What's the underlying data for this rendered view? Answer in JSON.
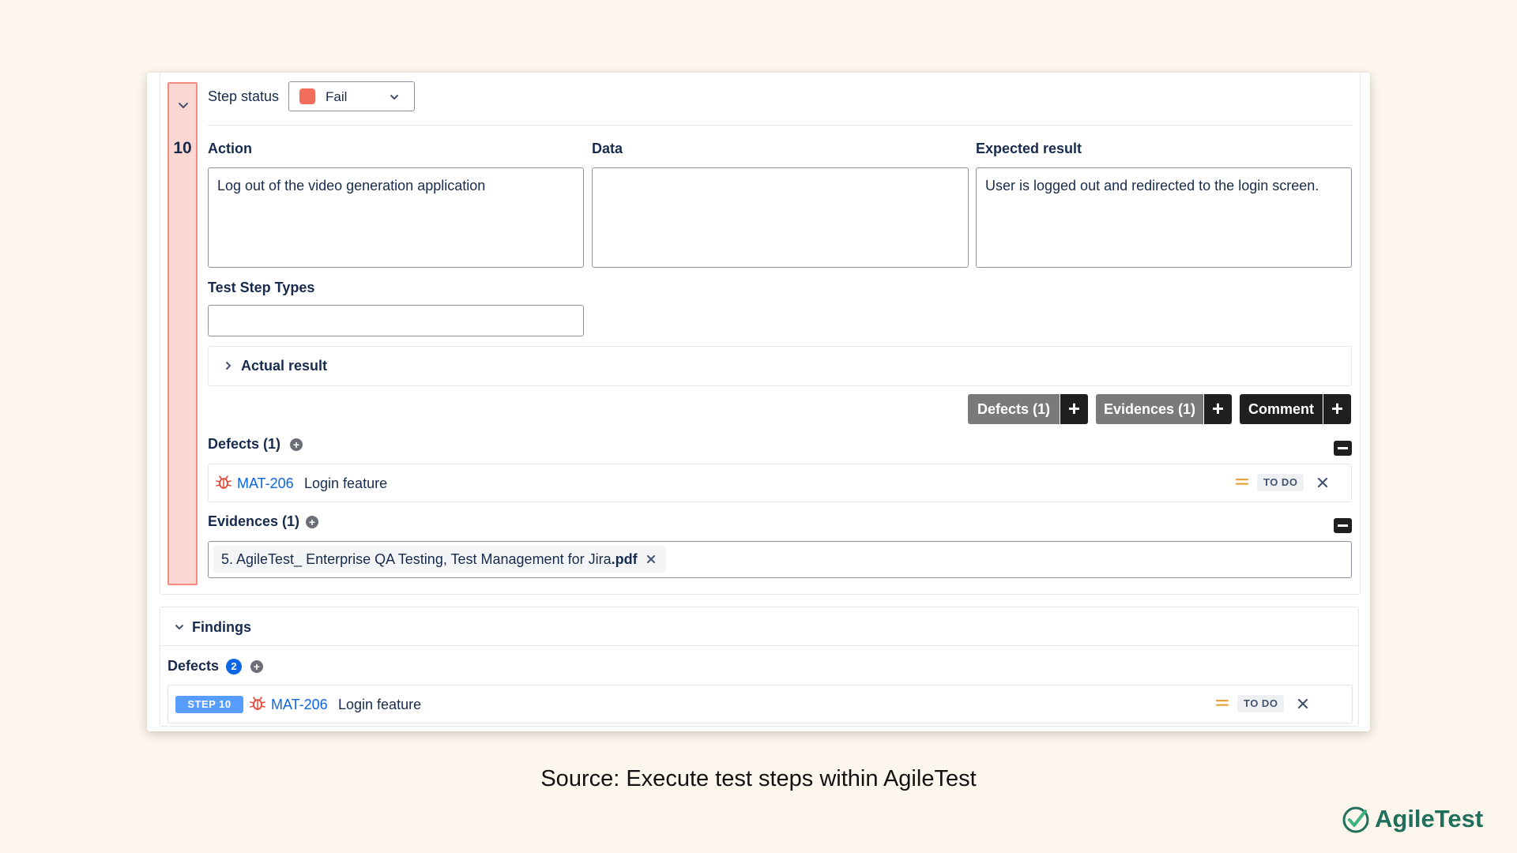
{
  "step": {
    "number": "10",
    "status_label": "Step status",
    "status_value": "Fail",
    "status_color": "#f26c5c"
  },
  "fields": {
    "action_label": "Action",
    "action_value": "Log out of the video generation application",
    "data_label": "Data",
    "data_value": "",
    "expected_label": "Expected result",
    "expected_value": "User is logged out and redirected to the login screen.",
    "step_types_label": "Test Step Types",
    "step_types_value": ""
  },
  "actual_result_label": "Actual result",
  "toolbar": {
    "defects_label": "Defects (1)",
    "evidences_label": "Evidences (1)",
    "comment_label": "Comment",
    "plus": "+"
  },
  "defects_section": {
    "label": "Defects (1)",
    "add": "+",
    "items": [
      {
        "key": "MAT-206",
        "title": "Login feature",
        "status": "TO DO"
      }
    ]
  },
  "evidences_section": {
    "label": "Evidences (1)",
    "add": "+",
    "files": [
      {
        "name": "5. AgileTest_ Enterprise QA Testing, Test Management for Jira",
        "ext": ".pdf"
      }
    ]
  },
  "findings": {
    "label": "Findings",
    "defects_label": "Defects",
    "defects_count": "2",
    "add": "+",
    "items": [
      {
        "step": "STEP 10",
        "key": "MAT-206",
        "title": "Login feature",
        "status": "TO DO"
      }
    ]
  },
  "caption": "Source: Execute test steps within AgileTest",
  "brand": {
    "name": "AgileTest",
    "color": "#1f6f5c"
  },
  "colors": {
    "fail_rail": "#fdd8d3",
    "link": "#0c66e4",
    "priority": "#e8a33d",
    "bug": "#e5493a"
  }
}
